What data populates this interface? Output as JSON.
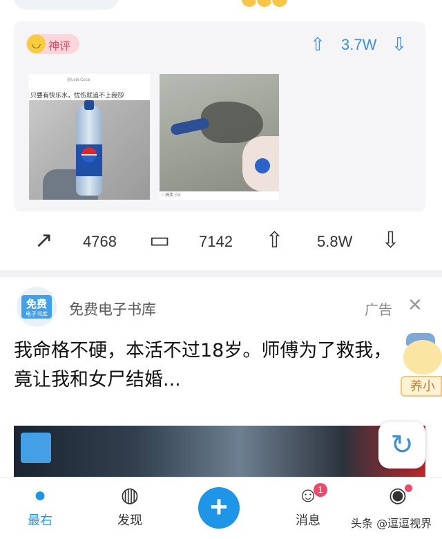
{
  "colors": {
    "accent": "#3d8fd6",
    "badge_pink": "#e2456a",
    "nav_active": "#1f95e8"
  },
  "hot_comment": {
    "badge_label": "神评",
    "badge_icon": "smiley-icon",
    "vote_count": "3.7W",
    "image1": {
      "user": "@Lola Coca",
      "caption": "只要有快乐水，忧伤就追不上我😼"
    },
    "image2": {
      "footer": "□ 搞笑 GX"
    }
  },
  "actions": {
    "share_count": "4768",
    "comment_count": "7142",
    "like_count": "5.8W"
  },
  "ad": {
    "logo_top": "免费",
    "logo_bottom": "电子书库",
    "name": "免费电子书库",
    "tag": "广告",
    "close": "✕",
    "title": "我命格不硬，本活不过18岁。师傅为了救我，竟让我和女尸结婚..."
  },
  "mascot_label": "养小",
  "nav": {
    "items": [
      {
        "label": "最右",
        "icon": "home-icon"
      },
      {
        "label": "发现",
        "icon": "planet-icon"
      },
      {
        "label": "消息",
        "icon": "message-icon",
        "badge": "1"
      },
      {
        "label": "",
        "icon": "profile-icon"
      }
    ]
  },
  "watermark": "头条 @逗逗视界"
}
